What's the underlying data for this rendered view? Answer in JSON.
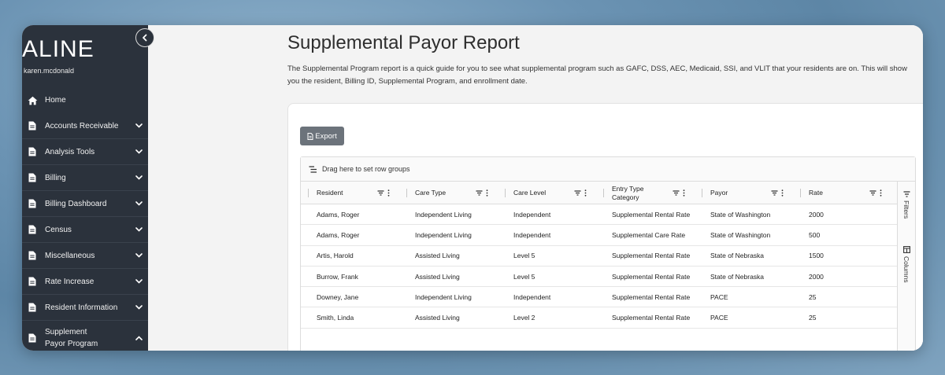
{
  "app": {
    "logo": "ALINE",
    "username": "karen.mcdonald"
  },
  "sidebar": {
    "items": [
      {
        "label": "Home",
        "icon": "home-icon",
        "expandable": false
      },
      {
        "label": "Accounts Receivable",
        "icon": "document-icon",
        "expandable": true
      },
      {
        "label": "Analysis Tools",
        "icon": "document-icon",
        "expandable": true
      },
      {
        "label": "Billing",
        "icon": "document-icon",
        "expandable": true
      },
      {
        "label": "Billing Dashboard",
        "icon": "document-icon",
        "expandable": true
      },
      {
        "label": "Census",
        "icon": "document-icon",
        "expandable": true
      },
      {
        "label": "Miscellaneous",
        "icon": "document-icon",
        "expandable": true
      },
      {
        "label": "Rate Increase",
        "icon": "document-icon",
        "expandable": true
      },
      {
        "label": "Resident Information",
        "icon": "document-icon",
        "expandable": true
      },
      {
        "label": "Supplement Payor Program",
        "icon": "document-icon",
        "expandable": true,
        "expanded": true
      }
    ]
  },
  "page": {
    "title": "Supplemental Payor Report",
    "description": "The Supplemental Program report is a quick guide for you to see what supplemental program such as GAFC, DSS, AEC, Medicaid, SSI, and VLIT that your residents are on. This will show you the resident, Billing ID, Supplemental Program, and enrollment date."
  },
  "toolbar": {
    "export_label": "Export"
  },
  "grid": {
    "group_bar_text": "Drag here to set row groups",
    "side_tabs": {
      "filters": "Filters",
      "columns": "Columns"
    },
    "columns": [
      "Resident",
      "Care Type",
      "Care Level",
      "Entry Type Category",
      "Payor",
      "Rate"
    ],
    "rows": [
      [
        "Adams, Roger",
        "Independent Living",
        "Independent",
        "Supplemental Rental Rate",
        "State of Washington",
        "2000"
      ],
      [
        "Adams, Roger",
        "Independent Living",
        "Independent",
        "Supplemental Care Rate",
        "State of Washington",
        "500"
      ],
      [
        "Artis, Harold",
        "Assisted Living",
        "Level 5",
        "Supplemental Rental Rate",
        "State of Nebraska",
        "1500"
      ],
      [
        "Burrow, Frank",
        "Assisted Living",
        "Level 5",
        "Supplemental Rental Rate",
        "State of Nebraska",
        "2000"
      ],
      [
        "Downey, Jane",
        "Independent Living",
        "Independent",
        "Supplemental Rental Rate",
        "PACE",
        "25"
      ],
      [
        "Smith, Linda",
        "Assisted Living",
        "Level 2",
        "Supplemental Rental Rate",
        "PACE",
        "25"
      ]
    ]
  },
  "colors": {
    "sidebar_bg": "#2b323c",
    "export_button": "#6c737b",
    "content_bg": "#f3f3f3"
  }
}
